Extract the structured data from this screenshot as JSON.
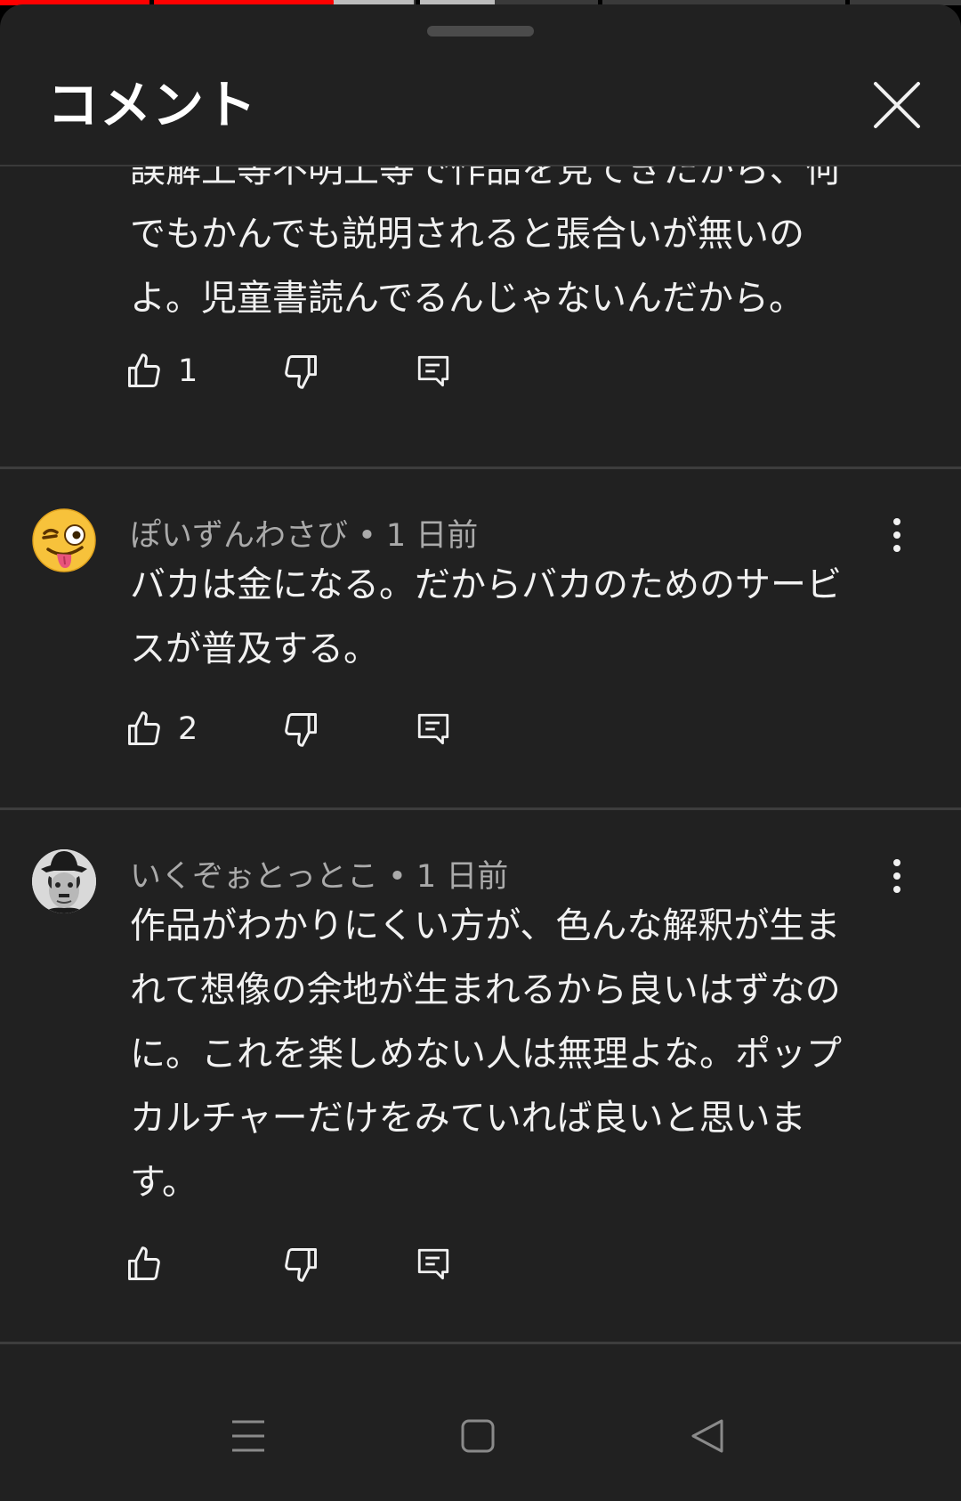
{
  "playback": {
    "progress_fraction": 0.33
  },
  "sheet": {
    "title": "コメント",
    "close_icon": "close-icon"
  },
  "comments": [
    {
      "text": "誤解上等不明上等で作品を見てきたから、何\nでもかんでも説明されると張合いが無いの\nよ。児童書読んでるんじゃないんだから。",
      "likes": "1"
    },
    {
      "author": "ぽいずんわさび",
      "time": "1 日前",
      "meta": "ぽいずんわさび • 1 日前",
      "avatar_icon": "winking-face-with-tongue-emoji",
      "text": "バカは金になる。だからバカのためのサービ\nスが普及する。",
      "likes": "2"
    },
    {
      "author": "いくぞぉとっとこ",
      "time": "1 日前",
      "meta": "いくぞぉとっとこ • 1 日前",
      "avatar_icon": "bowler-hat-portrait-avatar",
      "text": "作品がわかりにくい方が、色んな解釈が生ま\nれて想像の余地が生まれるから良いはずなの\nに。これを楽しめない人は無理よな。ポップ\nカルチャーだけをみていれば良いと思いま\nす。",
      "likes": ""
    }
  ],
  "icons": {
    "like": "thumb-up-icon",
    "dislike": "thumb-down-icon",
    "reply": "reply-comment-icon",
    "more": "more-vert-icon"
  },
  "navigation": {
    "recent": "recent-apps-icon",
    "home": "home-icon",
    "back": "back-icon"
  },
  "colors": {
    "sheet_bg": "#212121",
    "text": "#f1f1f1",
    "meta_text": "#aaaaaa",
    "accent_red": "#ff0000"
  }
}
